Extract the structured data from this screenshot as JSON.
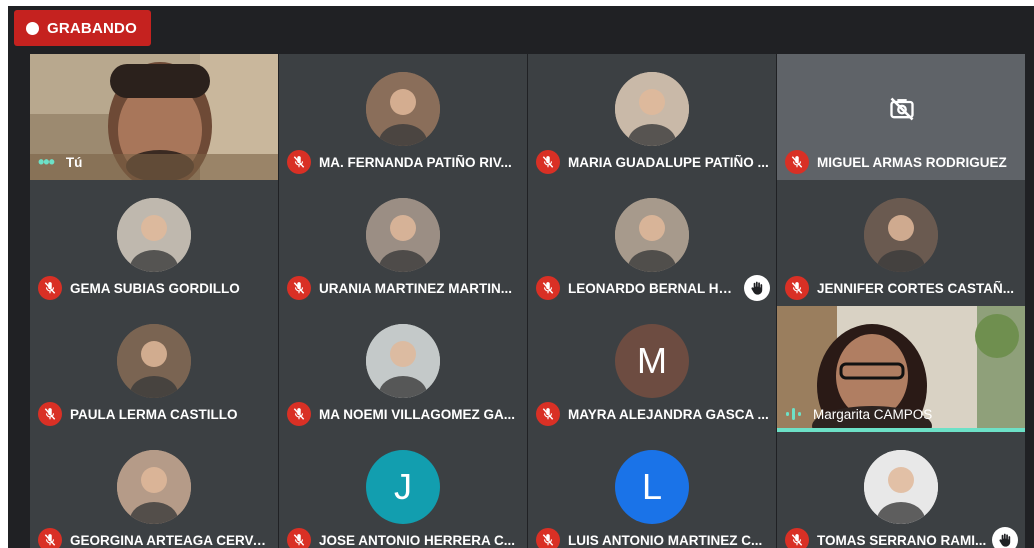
{
  "recording": {
    "label": "GRABANDO"
  },
  "self": {
    "label": "Tú"
  },
  "participants": [
    {
      "name": "MA. FERNANDA PATIÑO RIV...",
      "avatar_type": "photo",
      "avatar_color": "#8a6e5a"
    },
    {
      "name": "MARIA GUADALUPE PATIÑO ...",
      "avatar_type": "photo",
      "avatar_color": "#c9b9a8"
    },
    {
      "name": "MIGUEL ARMAS RODRIGUEZ",
      "avatar_type": "camera-off"
    },
    {
      "name": "GEMA SUBIAS GORDILLO",
      "avatar_type": "photo",
      "avatar_color": "#bfb8ae"
    },
    {
      "name": "URANIA MARTINEZ MARTIN...",
      "avatar_type": "photo",
      "avatar_color": "#9b8e84"
    },
    {
      "name": "LEONARDO BERNAL HA...",
      "avatar_type": "photo",
      "avatar_color": "#a79a8c",
      "hand_raised": true
    },
    {
      "name": "JENNIFER CORTES CASTAÑ...",
      "avatar_type": "photo",
      "avatar_color": "#6a5a50"
    },
    {
      "name": "PAULA LERMA CASTILLO",
      "avatar_type": "photo",
      "avatar_color": "#7a6452"
    },
    {
      "name": "MA NOEMI VILLAGOMEZ GA...",
      "avatar_type": "photo",
      "avatar_color": "#c4c9c9"
    },
    {
      "name": "MAYRA ALEJANDRA GASCA ...",
      "avatar_type": "initial",
      "initial": "M",
      "avatar_color": "#6d4c41"
    },
    {
      "name": "Margarita CAMPOS",
      "avatar_type": "video",
      "speaking": true
    },
    {
      "name": "GEORGINA ARTEAGA CERVA...",
      "avatar_type": "photo",
      "avatar_color": "#b59b88"
    },
    {
      "name": "JOSE ANTONIO HERRERA C...",
      "avatar_type": "initial",
      "initial": "J",
      "avatar_color": "#129eaf"
    },
    {
      "name": "LUIS ANTONIO MARTINEZ C...",
      "avatar_type": "initial",
      "initial": "L",
      "avatar_color": "#1a73e8"
    },
    {
      "name": "TOMAS SERRANO RAMI...",
      "avatar_type": "photo",
      "avatar_color": "#e8e8e8",
      "hand_raised": true
    }
  ],
  "colors": {
    "background": "#202124",
    "tile": "#3c4043",
    "mic_off": "#d93025",
    "recording": "#c5221f",
    "speaking": "#6de1c7"
  }
}
